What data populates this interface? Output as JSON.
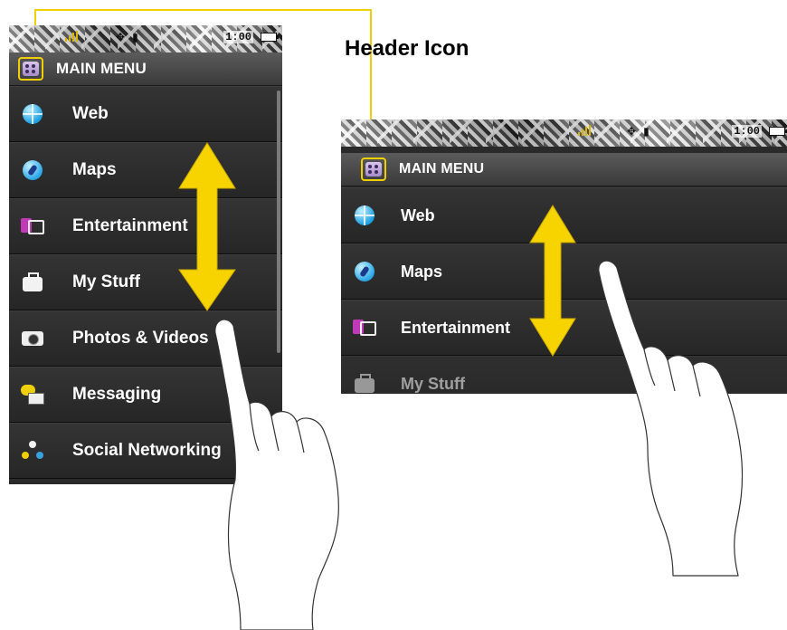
{
  "callout": {
    "label": "Header Icon"
  },
  "status_bar": {
    "time": "1:00"
  },
  "header": {
    "title": "MAIN MENU",
    "icon": "main-menu-grid-icon"
  },
  "portrait_menu": {
    "items": [
      {
        "label": "Web",
        "icon": "globe-icon"
      },
      {
        "label": "Maps",
        "icon": "compass-icon"
      },
      {
        "label": "Entertainment",
        "icon": "music-tv-icon"
      },
      {
        "label": "My Stuff",
        "icon": "briefcase-icon"
      },
      {
        "label": "Photos & Videos",
        "icon": "camera-icon"
      },
      {
        "label": "Messaging",
        "icon": "speech-bubble-envelope-icon"
      },
      {
        "label": "Social Networking",
        "icon": "people-network-icon"
      }
    ]
  },
  "landscape_menu": {
    "items": [
      {
        "label": "Web",
        "icon": "globe-icon"
      },
      {
        "label": "Maps",
        "icon": "compass-icon"
      },
      {
        "label": "Entertainment",
        "icon": "music-tv-icon"
      },
      {
        "label": "My Stuff",
        "icon": "briefcase-icon"
      }
    ]
  },
  "colors": {
    "highlight": "#f2cf00",
    "menu_bg": "#2a2a2a",
    "header_bg": "#4a4a4a"
  }
}
